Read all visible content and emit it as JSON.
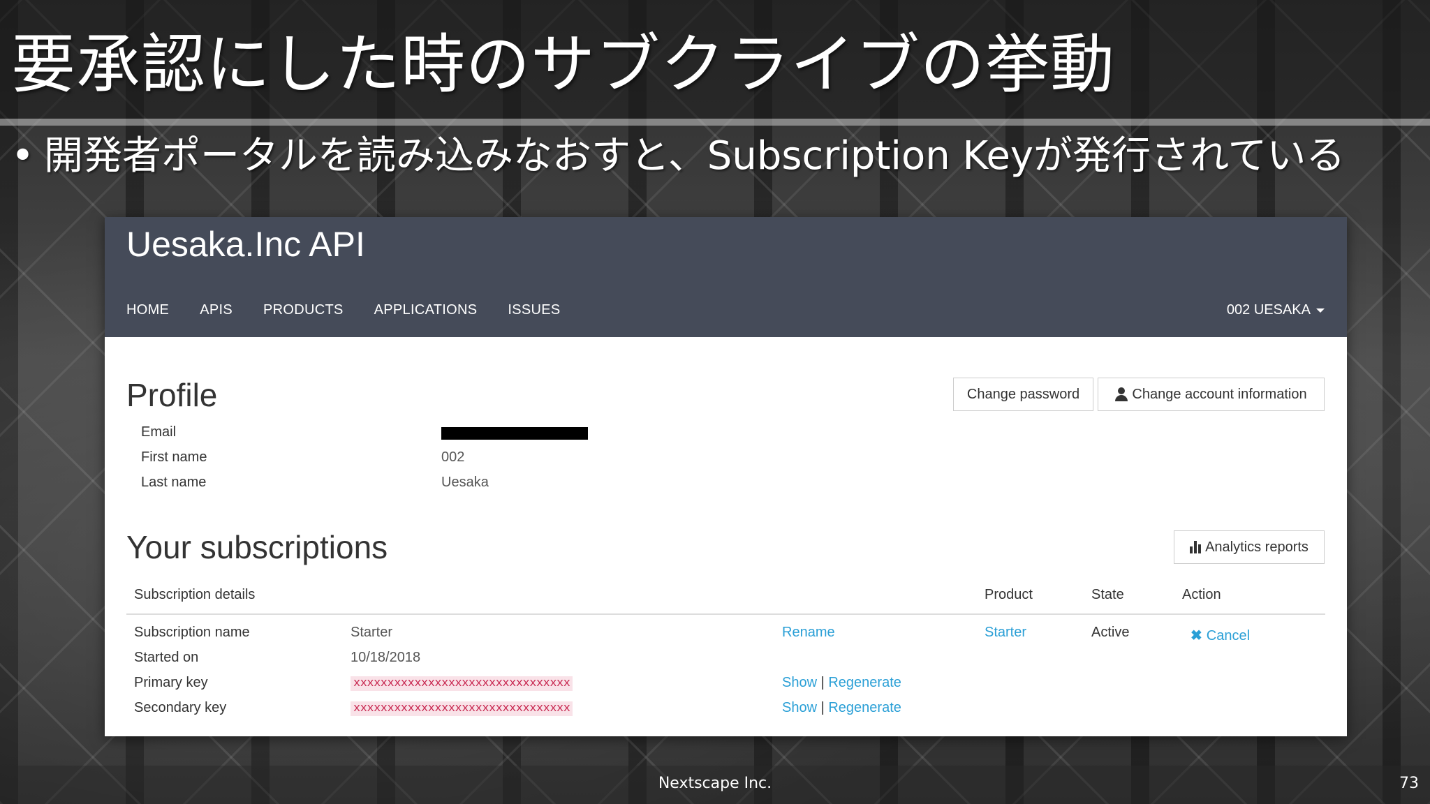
{
  "slide": {
    "title": "要承認にした時のサブクライブの挙動",
    "bullet_dot": "•",
    "bullet": "開発者ポータルを読み込みなおすと、Subscription Keyが発行されている",
    "footer": "Nextscape Inc.",
    "page_number": "73"
  },
  "portal": {
    "brand": "Uesaka.Inc API",
    "nav": [
      "HOME",
      "APIS",
      "PRODUCTS",
      "APPLICATIONS",
      "ISSUES"
    ],
    "user_menu": "002 UESAKA",
    "profile": {
      "heading": "Profile",
      "change_password": "Change password",
      "change_account": "Change account information",
      "fields": [
        {
          "label": "Email",
          "value": ""
        },
        {
          "label": "First name",
          "value": "002"
        },
        {
          "label": "Last name",
          "value": "Uesaka"
        }
      ]
    },
    "subscriptions": {
      "heading": "Your subscriptions",
      "analytics": "Analytics reports",
      "columns": [
        "Subscription details",
        "Product",
        "State",
        "Action"
      ],
      "rows": [
        {
          "label": "Subscription name",
          "value": "Starter"
        },
        {
          "label": "Started on",
          "value": "10/18/2018"
        },
        {
          "label": "Primary key",
          "value": "xxxxxxxxxxxxxxxxxxxxxxxxxxxxxxxx"
        },
        {
          "label": "Secondary key",
          "value": "xxxxxxxxxxxxxxxxxxxxxxxxxxxxxxxx"
        }
      ],
      "rename": "Rename",
      "show": "Show",
      "separator": "|",
      "regenerate": "Regenerate",
      "product": "Starter",
      "state": "Active",
      "cancel": "Cancel"
    }
  },
  "colors": {
    "header_bg": "#454b59",
    "link": "#2a9fd6",
    "key_text": "#c7254e",
    "key_bg": "#f9e2e8"
  }
}
